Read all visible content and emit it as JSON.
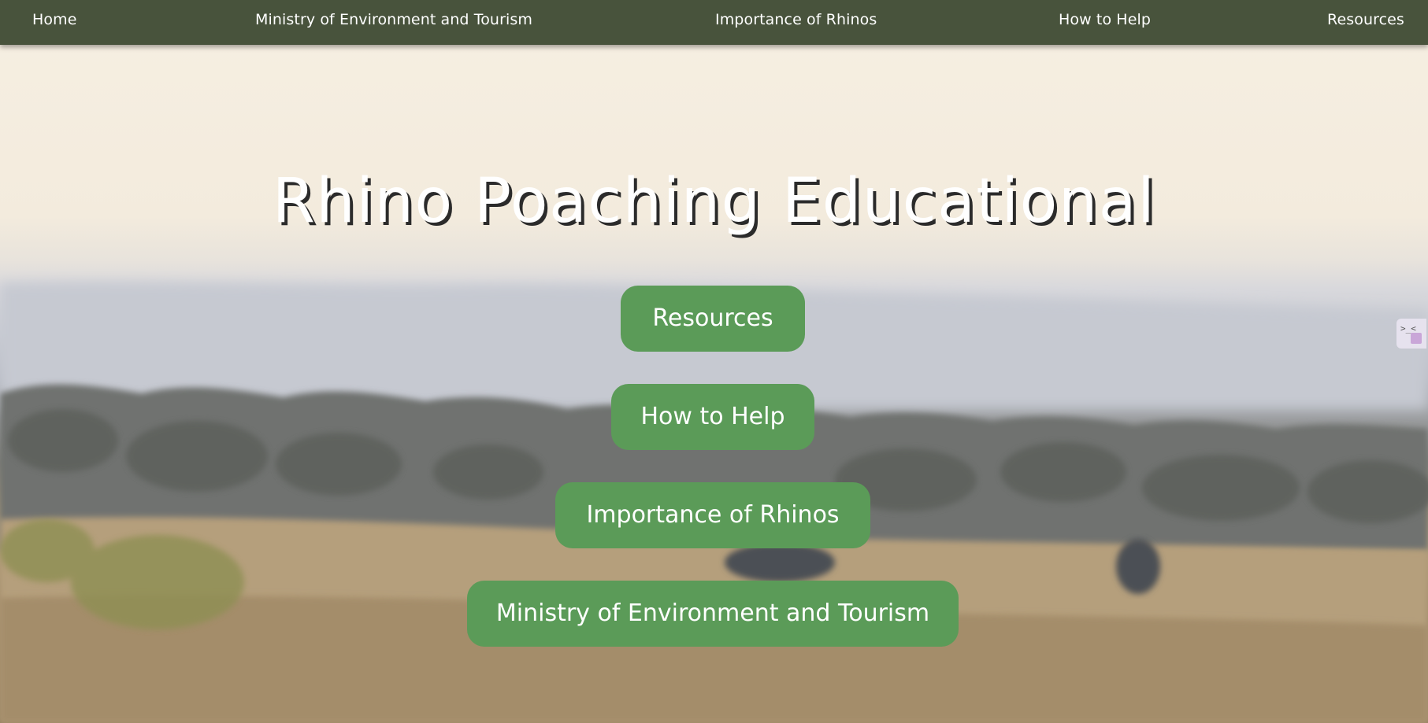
{
  "nav": {
    "home": "Home",
    "ministry": "Ministry of Environment and Tourism",
    "importance": "Importance of Rhinos",
    "help": "How to Help",
    "resources": "Resources"
  },
  "hero": {
    "title": "Rhino Poaching Educational",
    "buttons": {
      "resources": "Resources",
      "help": "How to Help",
      "importance": "Importance of Rhinos",
      "ministry": "Ministry of Environment and Tourism"
    }
  },
  "side_widget": {
    "glyph": ">_<"
  },
  "colors": {
    "navbar": "#48533c",
    "button": "#5b9b58",
    "title_shadow": "#2b2b2b"
  }
}
